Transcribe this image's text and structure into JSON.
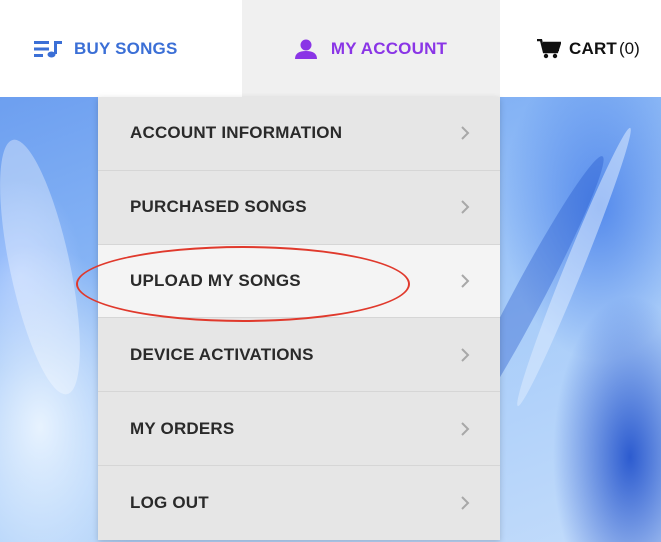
{
  "nav": {
    "buy_songs": {
      "label": "BUY SONGS",
      "icon": "playlist-icon"
    },
    "my_account": {
      "label": "MY ACCOUNT",
      "icon": "user-icon"
    },
    "cart": {
      "label": "CART",
      "count": "(0)",
      "icon": "cart-icon"
    }
  },
  "menu": {
    "items": [
      {
        "label": "ACCOUNT INFORMATION"
      },
      {
        "label": "PURCHASED SONGS"
      },
      {
        "label": "UPLOAD MY SONGS"
      },
      {
        "label": "DEVICE ACTIVATIONS"
      },
      {
        "label": "MY ORDERS"
      },
      {
        "label": "LOG OUT"
      }
    ],
    "highlighted_item": "UPLOAD MY SONGS"
  },
  "colors": {
    "buy_songs": "#3b6fd6",
    "my_account": "#8a35e6",
    "annotation": "#e0392c"
  }
}
